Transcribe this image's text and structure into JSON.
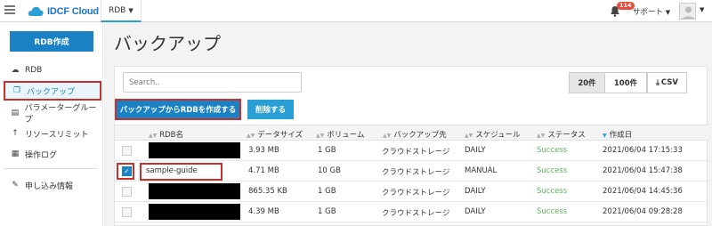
{
  "header": {
    "brand": "IDCF Cloud",
    "product_menu": "RDB",
    "notification_count": "114",
    "support_label": "サポート",
    "colors": {
      "brand": "#1b73c4",
      "accent": "#2a9fd6",
      "badge": "#e74c3c"
    }
  },
  "sidebar": {
    "create_button": "RDB作成",
    "items": [
      {
        "label": "RDB",
        "icon": "cloud-icon"
      },
      {
        "label": "バックアップ",
        "icon": "copy-icon"
      },
      {
        "label": "パラメーターグループ",
        "icon": "list-icon"
      },
      {
        "label": "リソースリミット",
        "icon": "arrow-up-icon"
      },
      {
        "label": "操作ログ",
        "icon": "document-icon"
      },
      {
        "label": "申し込み情報",
        "icon": "handshake-icon"
      }
    ]
  },
  "main": {
    "title": "バックアップ",
    "search_placeholder": "Search..",
    "page_size_options": [
      "20件",
      "100件"
    ],
    "page_size_selected": "20件",
    "csv_label": "CSV",
    "create_from_backup": "バックアップからRDBを作成する",
    "delete_label": "削除する"
  },
  "table": {
    "headers": [
      "RDB名",
      "データサイズ",
      "ボリューム",
      "バックアップ先",
      "スケジュール",
      "ステータス",
      "作成日"
    ],
    "rows": [
      {
        "checked": false,
        "name": "",
        "size": "3.93 MB",
        "volume": "1 GB",
        "dest": "クラウドストレージ",
        "schedule": "DAILY",
        "status": "Success",
        "created": "2021/06/04 17:15:33"
      },
      {
        "checked": true,
        "name": "sample-guide",
        "size": "4.71 MB",
        "volume": "10 GB",
        "dest": "クラウドストレージ",
        "schedule": "MANUAL",
        "status": "Success",
        "created": "2021/06/04 15:47:38"
      },
      {
        "checked": false,
        "name": "",
        "size": "865.35 KB",
        "volume": "1 GB",
        "dest": "クラウドストレージ",
        "schedule": "DAILY",
        "status": "Success",
        "created": "2021/06/04 14:45:36"
      },
      {
        "checked": false,
        "name": "",
        "size": "4.39 MB",
        "volume": "1 GB",
        "dest": "クラウドストレージ",
        "schedule": "DAILY",
        "status": "Success",
        "created": "2021/06/04 09:28:28"
      }
    ]
  }
}
